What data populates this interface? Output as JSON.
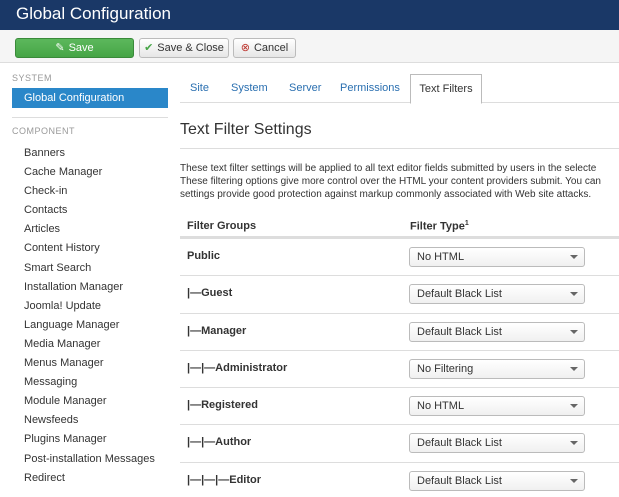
{
  "header": {
    "title": "Global Configuration"
  },
  "toolbar": {
    "save_label": "Save",
    "save_close_label": "Save & Close",
    "cancel_label": "Cancel"
  },
  "sidebar": {
    "system_heading": "SYSTEM",
    "active_item": "Global Configuration",
    "component_heading": "COMPONENT",
    "items": [
      "Banners",
      "Cache Manager",
      "Check-in",
      "Contacts",
      "Articles",
      "Content History",
      "Smart Search",
      "Installation Manager",
      "Joomla! Update",
      "Language Manager",
      "Media Manager",
      "Menus Manager",
      "Messaging",
      "Module Manager",
      "Newsfeeds",
      "Plugins Manager",
      "Post-installation Messages",
      "Redirect"
    ]
  },
  "tabs": {
    "site": "Site",
    "system": "System",
    "server": "Server",
    "permissions": "Permissions",
    "text_filters": "Text Filters"
  },
  "main": {
    "title": "Text Filter Settings",
    "desc_line1": "These text filter settings will be applied to all text editor fields submitted by users in the selecte",
    "desc_line2": "These filtering options give more control over the HTML your content providers submit. You can",
    "desc_line3": "settings provide good protection against markup commonly associated with Web site attacks.",
    "col_groups": "Filter Groups",
    "col_type": "Filter Type",
    "col_type_sup": "1"
  },
  "filters": [
    {
      "group": "Public",
      "type": "No HTML"
    },
    {
      "group": "|—Guest",
      "type": "Default Black List"
    },
    {
      "group": "|—Manager",
      "type": "Default Black List"
    },
    {
      "group": "|—|—Administrator",
      "type": "No Filtering"
    },
    {
      "group": "|—Registered",
      "type": "No HTML"
    },
    {
      "group": "|—|—Author",
      "type": "Default Black List"
    },
    {
      "group": "|—|—|—Editor",
      "type": "Default Black List"
    }
  ]
}
